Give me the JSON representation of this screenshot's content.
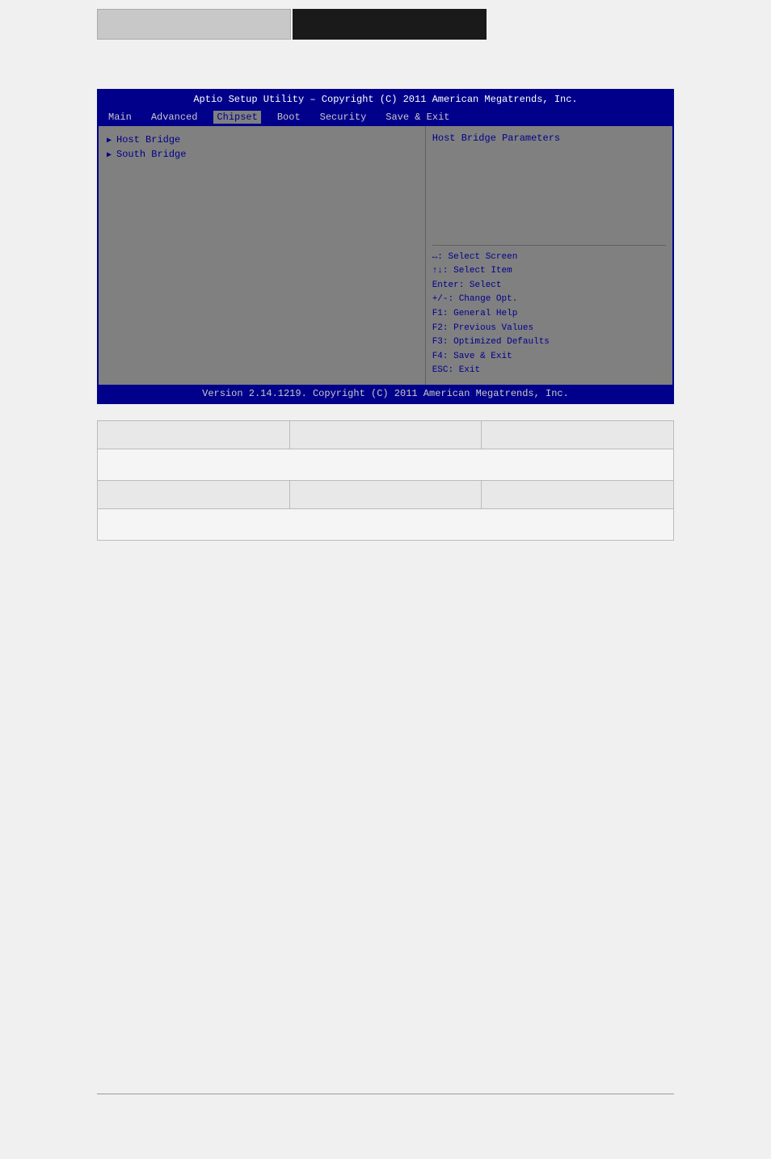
{
  "header": {
    "left_block": "",
    "right_block": ""
  },
  "bios": {
    "title": "Aptio Setup Utility – Copyright (C) 2011 American Megatrends, Inc.",
    "nav_items": [
      {
        "label": "Main",
        "active": false
      },
      {
        "label": "Advanced",
        "active": false
      },
      {
        "label": "Chipset",
        "active": true
      },
      {
        "label": "Boot",
        "active": false
      },
      {
        "label": "Security",
        "active": false
      },
      {
        "label": "Save & Exit",
        "active": false
      }
    ],
    "menu_items": [
      {
        "label": "Host Bridge"
      },
      {
        "label": "South Bridge"
      }
    ],
    "help_text": "Host Bridge Parameters",
    "key_help": [
      "↔: Select Screen",
      "↑↓: Select Item",
      "Enter: Select",
      "+/-: Change Opt.",
      "F1: General Help",
      "F2: Previous Values",
      "F3: Optimized Defaults",
      "F4: Save & Exit",
      "ESC: Exit"
    ],
    "footer": "Version 2.14.1219. Copyright (C) 2011 American Megatrends, Inc."
  },
  "table": {
    "row1": {
      "col1": "",
      "col2": "",
      "col3": ""
    },
    "row2": {
      "content": ""
    },
    "row3": {
      "col1": "",
      "col2": "",
      "col3": ""
    },
    "row4": {
      "content": ""
    }
  },
  "shortcuts": {
    "select_label": "Select",
    "item_label": "Item"
  }
}
